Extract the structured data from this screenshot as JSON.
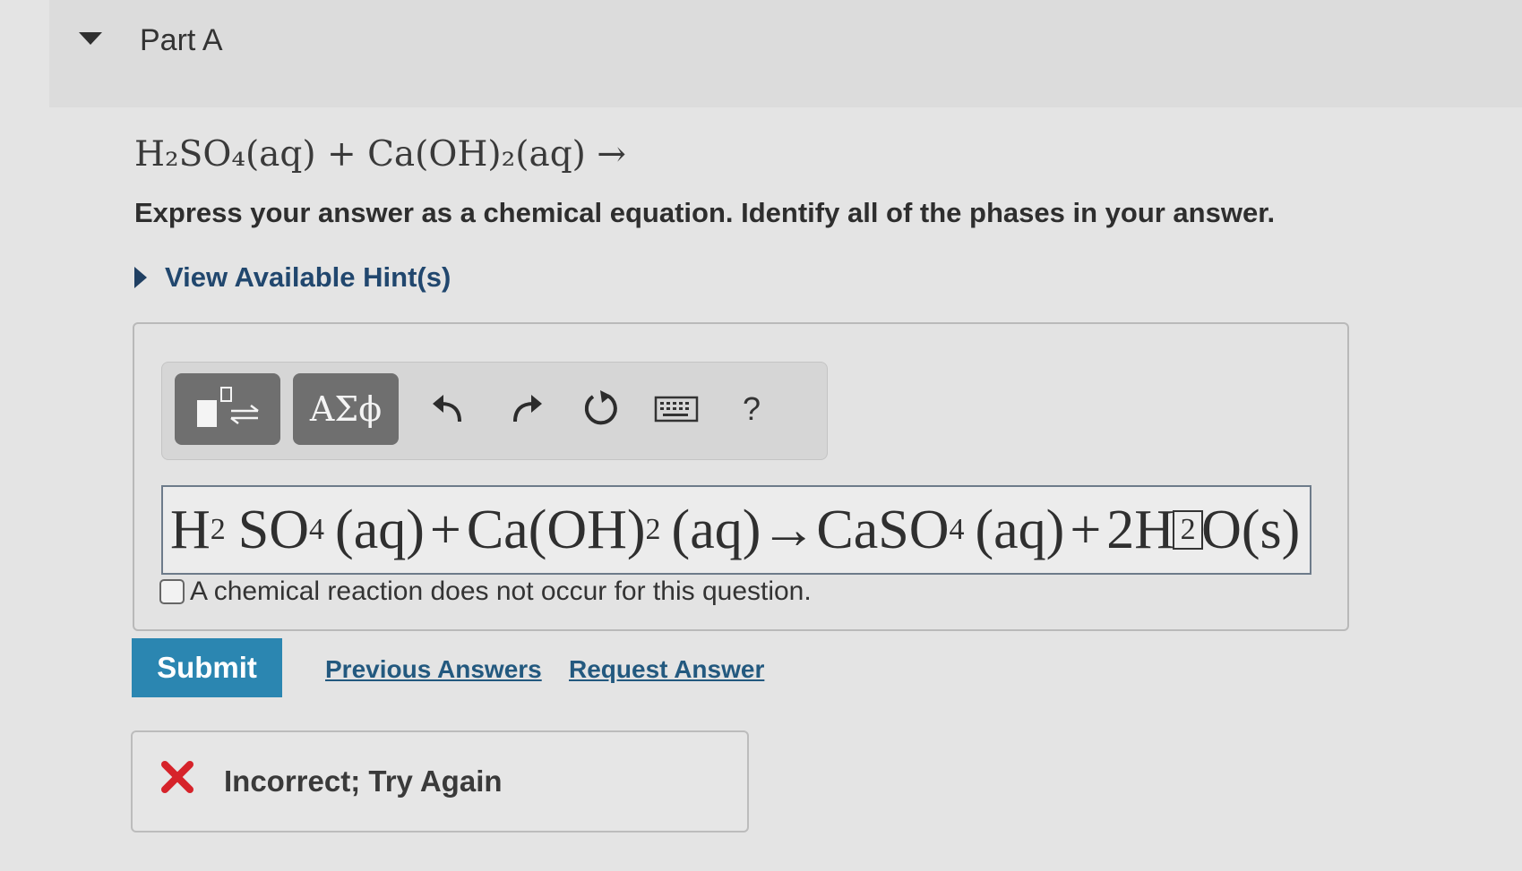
{
  "part": {
    "title": "Part A"
  },
  "question": {
    "equation": "H₂SO₄(aq) + Ca(OH)₂(aq) →",
    "instructions": "Express your answer as a chemical equation. Identify all of the phases in your answer."
  },
  "hints": {
    "label": "View Available Hint(s)"
  },
  "toolbar": {
    "symbols_label": "ΑΣϕ",
    "help_label": "?",
    "icons": [
      "templates-icon",
      "undo-icon",
      "redo-icon",
      "reset-icon",
      "keyboard-icon",
      "help-icon"
    ]
  },
  "answer": {
    "h": "H",
    "s2": "2",
    "so": "SO",
    "s4": "4",
    "aq1": "(aq)",
    "plus1": "+",
    "caoh": "Ca(OH)",
    "s2b": "2",
    "aq2": "(aq)",
    "arrow": "→",
    "caso": "CaSO",
    "s4b": "4",
    "aq3": "(aq)",
    "plus2": "+",
    "h2": "2H",
    "cursor_value": "2",
    "o_s": "O(s)"
  },
  "no_reaction": {
    "label": "A chemical reaction does not occur for this question.",
    "checked": false
  },
  "actions": {
    "submit_label": "Submit",
    "previous_answers_label": "Previous Answers",
    "request_answer_label": "Request Answer"
  },
  "feedback": {
    "text": "Incorrect; Try Again",
    "color": "#d6232a"
  }
}
